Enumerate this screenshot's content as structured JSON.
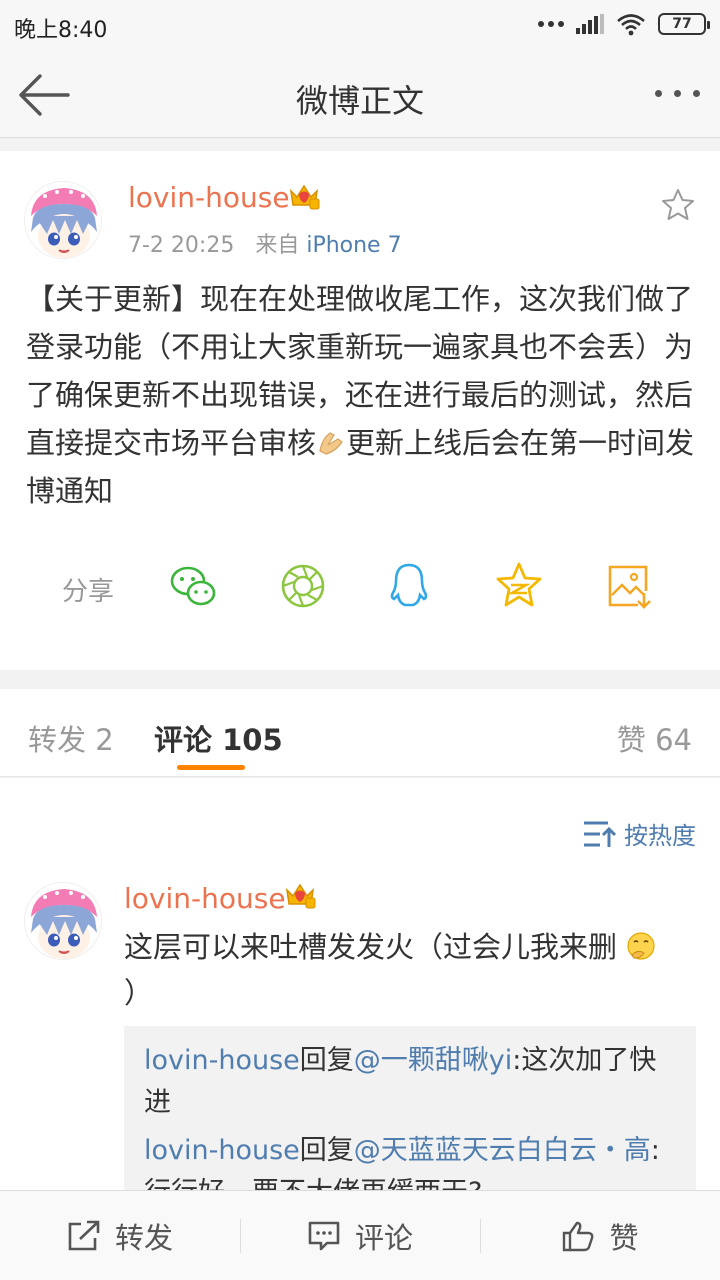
{
  "status_bar": {
    "time": "晚上8:40",
    "battery": "77"
  },
  "nav": {
    "title": "微博正文"
  },
  "post": {
    "user_name": "lovin-house",
    "date": "7-2 20:25",
    "source_prefix": "来自",
    "source": "iPhone 7",
    "text_before_emoji": "【关于更新】现在在处理做收尾工作，这次我们做了登录功能（不用让大家重新玩一遍家具也不会丢）为了确保更新不出现错误，还在进行最后的测试，然后直接提交市场平台审核",
    "text_after_emoji": "更新上线后会在第一时间发博通知"
  },
  "share": {
    "label": "分享",
    "targets": [
      "wechat-icon",
      "moments-icon",
      "qq-icon",
      "qzone-icon",
      "save-image-icon"
    ]
  },
  "tabs": {
    "repost": "转发 2",
    "comment": "评论 105",
    "like": "赞 64"
  },
  "sort": {
    "label": "按热度"
  },
  "comment": {
    "user_name": "lovin-house",
    "text_before_emoji": "这层可以来吐槽发发火（过会儿我来删",
    "text_after_emoji": "）",
    "replies": [
      {
        "user": "lovin-house",
        "verb": "回复",
        "target": "@一颗甜啾yi",
        "text": ":这次加了快进"
      },
      {
        "user": "lovin-house",
        "verb": "回复",
        "target": "@天蓝蓝天云白白云・高",
        "text": ":行行好，要不大佬再缓两天?"
      }
    ]
  },
  "bottom_bar": {
    "repost": "转发",
    "comment": "评论",
    "like": "赞"
  },
  "colors": {
    "username": "#eb7350",
    "link": "#507daf",
    "accent": "#ff8200"
  }
}
